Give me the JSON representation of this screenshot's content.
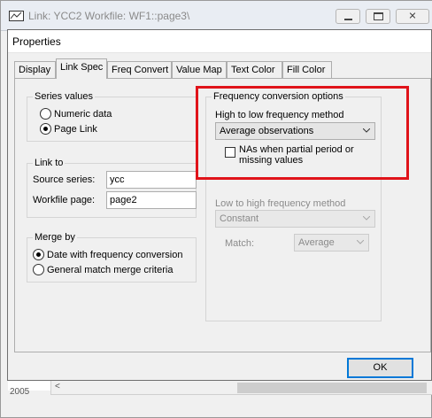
{
  "background_window": {
    "title": "Link: YCC2   Workfile: WF1::page3\\",
    "bottom_text": "2005"
  },
  "dialog": {
    "title": "Properties",
    "tabs": [
      {
        "label": "Display",
        "active": false
      },
      {
        "label": "Link Spec",
        "active": true
      },
      {
        "label": "Freq Convert",
        "active": false
      },
      {
        "label": "Value Map",
        "active": false
      },
      {
        "label": "Text Color",
        "active": false
      },
      {
        "label": "Fill Color",
        "active": false
      }
    ],
    "series_values": {
      "heading": "Series values",
      "options": [
        {
          "label": "Numeric data",
          "selected": false
        },
        {
          "label": "Page Link",
          "selected": true
        }
      ]
    },
    "link_to": {
      "heading": "Link to",
      "source_series_label": "Source series:",
      "source_series_value": "ycc",
      "workfile_page_label": "Workfile page:",
      "workfile_page_value": "page2"
    },
    "merge_by": {
      "heading": "Merge by",
      "options": [
        {
          "label": "Date with frequency conversion",
          "selected": true
        },
        {
          "label": "General match merge criteria",
          "selected": false
        }
      ]
    },
    "freq_conversion": {
      "heading": "Frequency conversion options",
      "high_to_low_label": "High to low frequency method",
      "high_to_low_value": "Average observations",
      "na_checkbox_label_line1": "NAs when partial period or",
      "na_checkbox_label_line2": "missing values",
      "na_checked": false,
      "low_to_high_label": "Low to high frequency method",
      "low_to_high_value": "Constant",
      "match_label": "Match:",
      "match_value": "Average"
    },
    "ok_label": "OK"
  },
  "colors": {
    "highlight": "#e0131a",
    "ok_border": "#0078d7"
  }
}
